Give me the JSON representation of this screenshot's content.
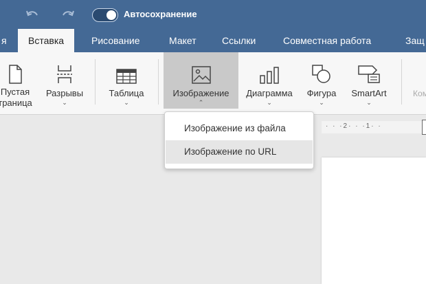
{
  "titlebar": {
    "undo_icon": "undo-icon",
    "redo_icon": "redo-icon",
    "autosave_label": "Автосохранение",
    "autosave_on": true
  },
  "tabs": [
    {
      "label": "я",
      "active": false
    },
    {
      "label": "Вставка",
      "active": true
    },
    {
      "label": "Рисование",
      "active": false
    },
    {
      "label": "Макет",
      "active": false
    },
    {
      "label": "Ссылки",
      "active": false
    },
    {
      "label": "Совместная работа",
      "active": false
    },
    {
      "label": "Защ",
      "active": false
    }
  ],
  "ribbon": {
    "blank_page": {
      "label_line1": "Пустая",
      "label_line2": "траница",
      "icon": "blank-page-icon"
    },
    "breaks": {
      "label": "Разрывы",
      "icon": "page-break-icon"
    },
    "table": {
      "label": "Таблица",
      "icon": "table-icon"
    },
    "image": {
      "label": "Изображение",
      "icon": "image-icon",
      "pressed": true
    },
    "chart": {
      "label": "Диаграмма",
      "icon": "bar-chart-icon"
    },
    "shape": {
      "label": "Фигура",
      "icon": "shapes-icon"
    },
    "smartart": {
      "label": "SmartArt",
      "icon": "smartart-icon"
    },
    "comment": {
      "label": "Ком",
      "icon": "comment-icon"
    }
  },
  "image_menu": {
    "items": [
      {
        "label": "Изображение из файла"
      },
      {
        "label": "Изображение по URL"
      }
    ]
  },
  "ruler": {
    "ticks": "· · ·2· · ·1· ·"
  },
  "colors": {
    "accent": "#446995",
    "ribbon": "#f7f7f7",
    "canvas": "#e9e9e9"
  }
}
